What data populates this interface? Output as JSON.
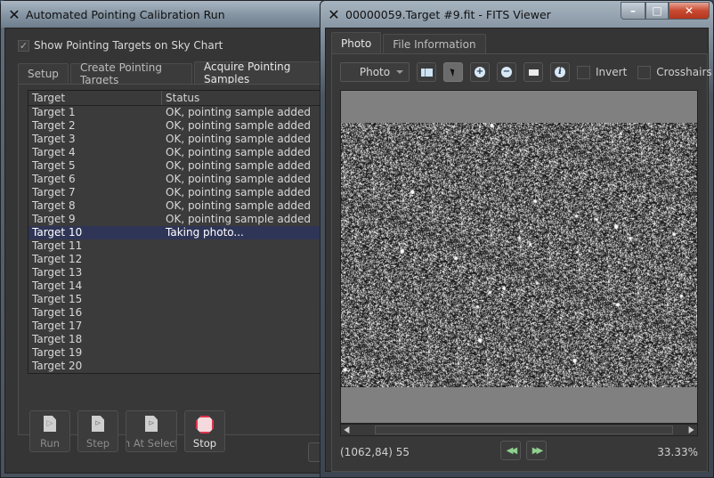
{
  "left_window": {
    "title": "Automated Pointing Calibration Run",
    "show_targets_checkbox": {
      "label": "Show Pointing Targets on Sky Chart",
      "checked": true,
      "check_glyph": "✓"
    },
    "tabs": [
      {
        "label": "Setup",
        "active": false
      },
      {
        "label": "Create Pointing Targets",
        "active": false
      },
      {
        "label": "Acquire Pointing Samples",
        "active": true
      }
    ],
    "table": {
      "columns": [
        "Target",
        "Status"
      ],
      "rows": [
        {
          "target": "Target 1",
          "status": "OK, pointing sample added"
        },
        {
          "target": "Target 2",
          "status": "OK, pointing sample added"
        },
        {
          "target": "Target 3",
          "status": "OK, pointing sample added"
        },
        {
          "target": "Target 4",
          "status": "OK, pointing sample added"
        },
        {
          "target": "Target 5",
          "status": "OK, pointing sample added"
        },
        {
          "target": "Target 6",
          "status": "OK, pointing sample added"
        },
        {
          "target": "Target 7",
          "status": "OK, pointing sample added"
        },
        {
          "target": "Target 8",
          "status": "OK, pointing sample added"
        },
        {
          "target": "Target 9",
          "status": "OK, pointing sample added"
        },
        {
          "target": "Target 10",
          "status": "Taking photo...",
          "selected": true
        },
        {
          "target": "Target 11",
          "status": ""
        },
        {
          "target": "Target 12",
          "status": ""
        },
        {
          "target": "Target 13",
          "status": ""
        },
        {
          "target": "Target 14",
          "status": ""
        },
        {
          "target": "Target 15",
          "status": ""
        },
        {
          "target": "Target 16",
          "status": ""
        },
        {
          "target": "Target 17",
          "status": ""
        },
        {
          "target": "Target 18",
          "status": ""
        },
        {
          "target": "Target 19",
          "status": ""
        },
        {
          "target": "Target 20",
          "status": ""
        }
      ]
    },
    "buttons": {
      "run": {
        "label": "Run",
        "enabled": false,
        "icon": "play-document-icon"
      },
      "step": {
        "label": "Step",
        "enabled": false,
        "icon": "step-document-icon"
      },
      "run_at_selection": {
        "label": "in At Selecti",
        "enabled": false,
        "icon": "run-at-selection-icon"
      },
      "stop": {
        "label": "Stop",
        "enabled": true,
        "icon": "stop-icon"
      }
    }
  },
  "right_window": {
    "title": "00000059.Target #9.fit - FITS Viewer",
    "controls": {
      "minimize": "–",
      "maximize": "□",
      "close": "✕"
    },
    "tabs": [
      {
        "label": "Photo",
        "active": true
      },
      {
        "label": "File Information",
        "active": false
      }
    ],
    "toolbar": {
      "view_select": "Photo",
      "histogram_icon": "histogram-icon",
      "pointer_icon": "pointer-icon",
      "zoom_in_glyph": "+",
      "zoom_out_glyph": "−",
      "zoom_fit_icon": "zoom-fit-icon",
      "info_glyph": "i",
      "invert": {
        "label": "Invert",
        "checked": false
      },
      "crosshairs": {
        "label": "Crosshairs",
        "checked": false
      }
    },
    "status": {
      "coordinates": "(1062,84) 55",
      "zoom": "33.33%",
      "prev_glyph": "◀◀",
      "next_glyph": "▶▶"
    },
    "colors": {
      "background_gray": "#808080",
      "selection_row": "#2f3556",
      "stop_red": "#e0334d",
      "nav_green": "#8fd08f"
    }
  }
}
